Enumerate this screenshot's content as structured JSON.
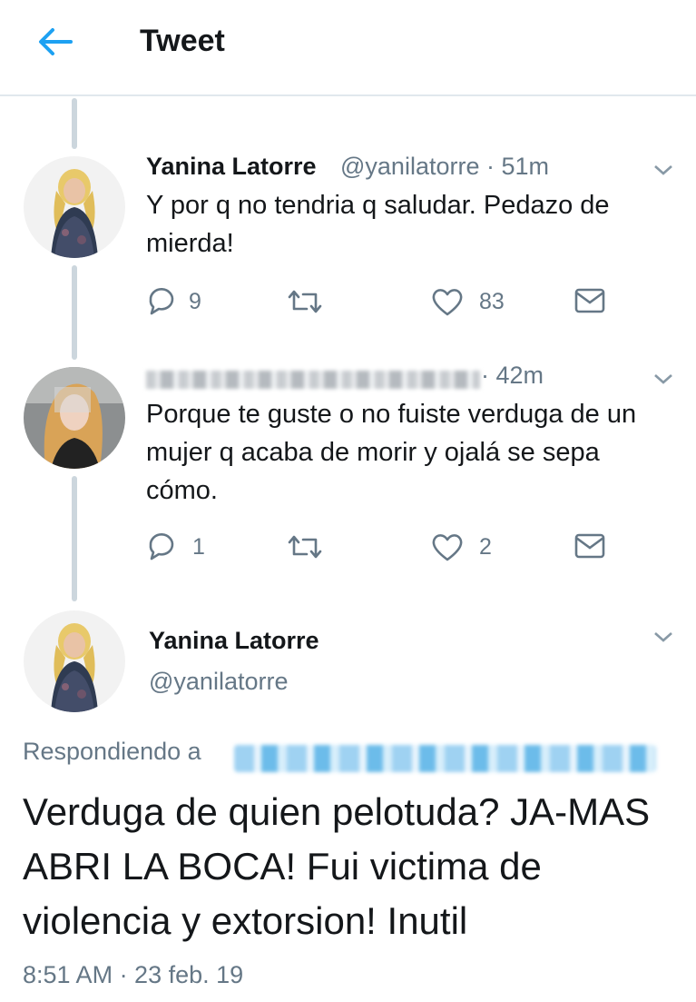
{
  "header": {
    "title": "Tweet"
  },
  "tweets": [
    {
      "name": "Yanina Latorre",
      "handle": "@yanilatorre",
      "time": " · 51m",
      "text": "Y por q no tendria q saludar. Pedazo de mierda!",
      "replies": "9",
      "retweets": "",
      "likes": "83"
    },
    {
      "name": "",
      "handle": "",
      "time": " · 42m",
      "text": "Porque te guste o no fuiste verduga de un mujer q acaba de morir y ojalá se sepa cómo.",
      "replies": "1",
      "retweets": "",
      "likes": "2"
    }
  ],
  "main_tweet": {
    "name": "Yanina Latorre",
    "handle": "@yanilatorre",
    "replying_to_label": "Respondiendo a",
    "text": "Verduga de quien pelotuda? JA-MAS ABRI LA BOCA! Fui victima de violencia y extorsion! Inutil",
    "timestamp": "8:51 AM · 23 feb. 19"
  },
  "colors": {
    "accent": "#1da1f2",
    "secondary_text": "#657786",
    "primary_text": "#14171a",
    "thread_line": "#ccd6dd"
  }
}
